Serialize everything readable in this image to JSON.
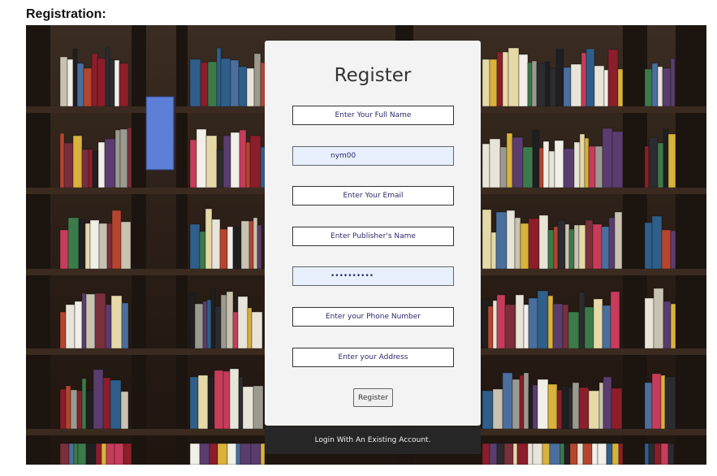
{
  "page": {
    "heading": "Registration:"
  },
  "card": {
    "title": "Register"
  },
  "fields": {
    "full_name": {
      "placeholder": "Enter Your Full Name",
      "value": ""
    },
    "username": {
      "placeholder": "",
      "value": "nym00"
    },
    "email": {
      "placeholder": "Enter Your Email",
      "value": ""
    },
    "publisher": {
      "placeholder": "Enter Publisher's Name",
      "value": ""
    },
    "password": {
      "placeholder": "",
      "value": "••••••••••"
    },
    "phone": {
      "placeholder": "Enter your Phone Number",
      "value": ""
    },
    "address": {
      "placeholder": "Enter your Address",
      "value": ""
    }
  },
  "buttons": {
    "register": "Register"
  },
  "footer": {
    "login_link": "Login With An Existing Account."
  },
  "colors": {
    "card_bg": "#f3f3f3",
    "footer_bg": "#262626",
    "autofill_bg": "#e8f0fe"
  }
}
